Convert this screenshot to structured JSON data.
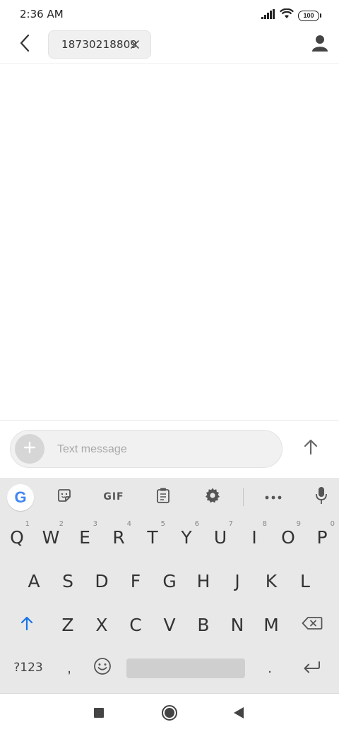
{
  "status_bar": {
    "time": "2:36 AM",
    "battery": "100",
    "icons": [
      "signal-icon",
      "wifi-icon",
      "battery-icon"
    ]
  },
  "header": {
    "recipient": "18730218809",
    "icons": [
      "back-arrow-icon",
      "close-icon",
      "person-icon"
    ]
  },
  "compose": {
    "placeholder": "Text message",
    "value": "",
    "icons": [
      "plus-icon",
      "send-arrow-icon"
    ]
  },
  "keyboard": {
    "toolbar": {
      "google_label": "G",
      "gif_label": "GIF",
      "icons": [
        "google-icon",
        "sticker-icon",
        "gif-icon",
        "clipboard-icon",
        "settings-icon",
        "more-icon",
        "mic-icon"
      ]
    },
    "row1": [
      {
        "label": "Q",
        "hint": "1"
      },
      {
        "label": "W",
        "hint": "2"
      },
      {
        "label": "E",
        "hint": "3"
      },
      {
        "label": "R",
        "hint": "4"
      },
      {
        "label": "T",
        "hint": "5"
      },
      {
        "label": "Y",
        "hint": "6"
      },
      {
        "label": "U",
        "hint": "7"
      },
      {
        "label": "I",
        "hint": "8"
      },
      {
        "label": "O",
        "hint": "9"
      },
      {
        "label": "P",
        "hint": "0"
      }
    ],
    "row2": [
      "A",
      "S",
      "D",
      "F",
      "G",
      "H",
      "J",
      "K",
      "L"
    ],
    "row3": [
      "Z",
      "X",
      "C",
      "V",
      "B",
      "N",
      "M"
    ],
    "bottom": {
      "numbers_label": "?123",
      "comma_label": ",",
      "period_label": "."
    },
    "accent_color": "#1a73e8"
  },
  "nav_bar": {
    "icons": [
      "recents-square-icon",
      "home-circle-icon",
      "back-triangle-icon"
    ]
  }
}
